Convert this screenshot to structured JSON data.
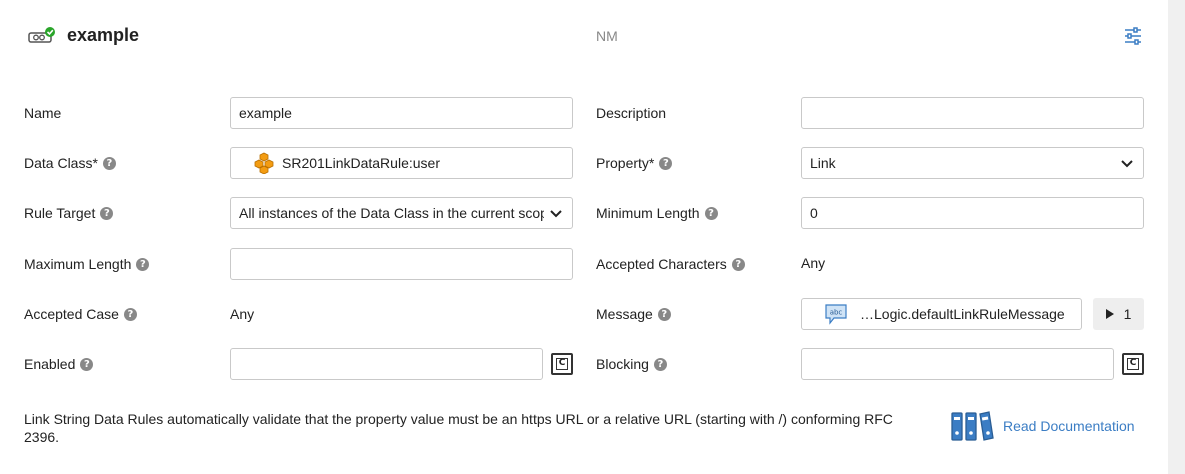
{
  "header": {
    "title": "example",
    "namespace": "NM"
  },
  "fields": {
    "name": {
      "label": "Name",
      "value": "example"
    },
    "description": {
      "label": "Description",
      "value": ""
    },
    "data_class": {
      "label": "Data Class*",
      "value": "SR201LinkDataRule:user"
    },
    "property": {
      "label": "Property*",
      "value": "Link"
    },
    "rule_target": {
      "label": "Rule Target",
      "value": "All instances of the Data Class in the current scope"
    },
    "minimum_length": {
      "label": "Minimum Length",
      "value": "0"
    },
    "maximum_length": {
      "label": "Maximum Length",
      "value": ""
    },
    "accepted_characters": {
      "label": "Accepted Characters",
      "value": "Any"
    },
    "accepted_case": {
      "label": "Accepted Case",
      "value": "Any"
    },
    "message": {
      "label": "Message",
      "value": "…Logic.defaultLinkRuleMessage",
      "run_count": "1"
    },
    "enabled": {
      "label": "Enabled",
      "value": ""
    },
    "blocking": {
      "label": "Blocking",
      "value": ""
    }
  },
  "help_glyph": "?",
  "toggle_glyph": "C",
  "footer": {
    "description": "Link String Data Rules automatically validate that the property value must be an https URL or a relative URL (starting with /) conforming RFC 2396.",
    "doc_link": "Read Documentation"
  },
  "icons": {
    "rule": "link-rule-icon",
    "settings": "sliders-icon",
    "data_class": "cubes-icon",
    "message": "text-message-icon",
    "docs": "binders-icon"
  },
  "colors": {
    "accent": "#3b7dc4",
    "success": "#2aa52a",
    "data_class_icon": "#f39c12"
  }
}
